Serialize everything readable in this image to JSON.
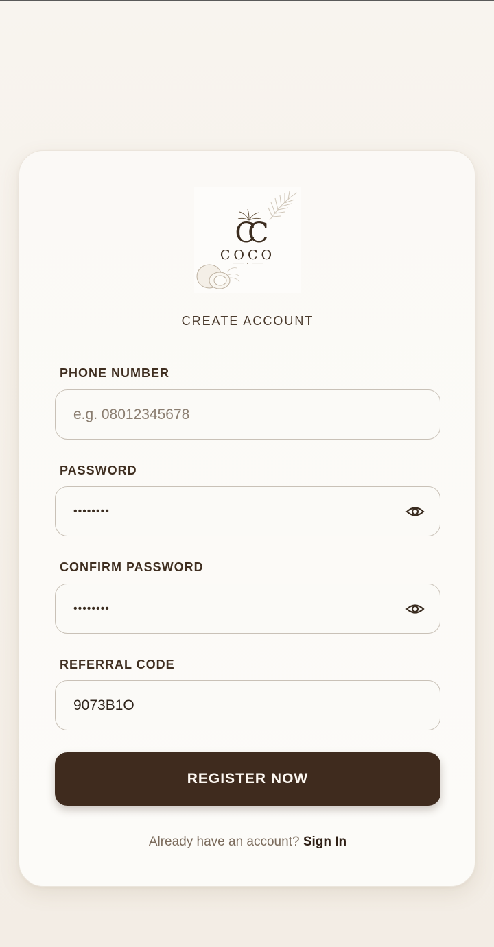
{
  "brand": {
    "monogram": "CC",
    "name": "COCO"
  },
  "heading": "CREATE ACCOUNT",
  "fields": {
    "phone": {
      "label": "PHONE NUMBER",
      "placeholder": "e.g. 08012345678",
      "value": ""
    },
    "password": {
      "label": "PASSWORD",
      "masked": "••••••••",
      "icon": "eye-icon"
    },
    "confirm_password": {
      "label": "CONFIRM PASSWORD",
      "masked": "••••••••",
      "icon": "eye-icon"
    },
    "referral": {
      "label": "REFERRAL CODE",
      "value": "9073B1O"
    }
  },
  "register_button": "REGISTER NOW",
  "footer": {
    "prompt": "Already have an account?",
    "link": "Sign In"
  },
  "colors": {
    "accent": "#3f2b1e",
    "label": "#3f2e20",
    "background": "#f8f4ef"
  }
}
